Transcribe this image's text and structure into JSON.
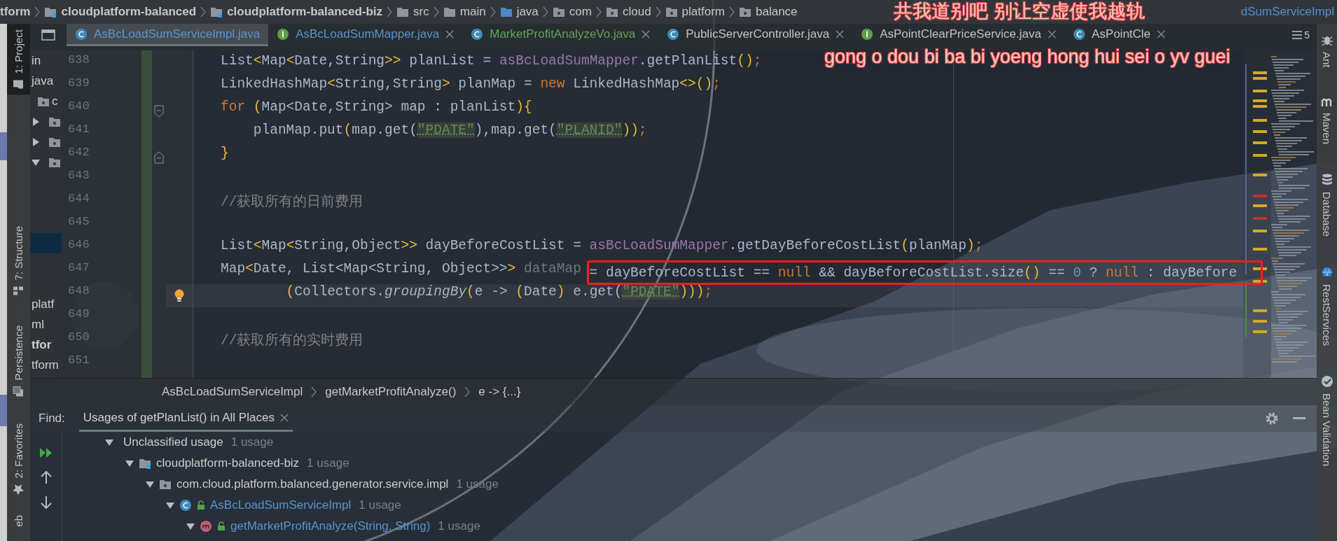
{
  "breadcrumbs": [
    {
      "label": "tform",
      "kind": "text"
    },
    {
      "label": "cloudplatform-balanced",
      "kind": "module"
    },
    {
      "label": "cloudplatform-balanced-biz",
      "kind": "module"
    },
    {
      "label": "src",
      "kind": "folder"
    },
    {
      "label": "main",
      "kind": "folder"
    },
    {
      "label": "java",
      "kind": "source"
    },
    {
      "label": "com",
      "kind": "package"
    },
    {
      "label": "cloud",
      "kind": "package"
    },
    {
      "label": "platform",
      "kind": "package"
    },
    {
      "label": "balance",
      "kind": "package"
    },
    {
      "label": "dSumServiceImpl",
      "kind": "class"
    }
  ],
  "lyrics_overlay": {
    "lines": [
      "共我道别吧 别让空虚使我越轨",
      "gong o dou bi ba bi yoeng hong hui sei o yv guei"
    ]
  },
  "left_tool_tabs": [
    {
      "label": "1: Project",
      "kind": "project",
      "selected": true
    },
    {
      "label": "7: Structure",
      "kind": "structure",
      "selected": false
    },
    {
      "label": "Persistence",
      "kind": "persistence",
      "selected": false
    },
    {
      "label": "2: Favorites",
      "kind": "favorites",
      "selected": false
    },
    {
      "label": "eb",
      "kind": "web",
      "selected": false
    }
  ],
  "right_tool_tabs": [
    {
      "label": "Ant",
      "kind": "ant"
    },
    {
      "label": "Maven",
      "kind": "maven"
    },
    {
      "label": "Database",
      "kind": "database"
    },
    {
      "label": "RestServices",
      "kind": "rest"
    },
    {
      "label": "Bean Validation",
      "kind": "bean"
    }
  ],
  "tabs": [
    {
      "label": "AsBcLoadSumServiceImpl.java",
      "kind": "class",
      "color": "#5895d0",
      "selected": true
    },
    {
      "label": "AsBcLoadSumMapper.java",
      "kind": "interface",
      "color": "#5895d0",
      "selected": false
    },
    {
      "label": "MarketProfitAnalyzeVo.java",
      "kind": "class",
      "color": "#62a55a",
      "selected": false
    },
    {
      "label": "PublicServerController.java",
      "kind": "class",
      "color": "#c2c2c2",
      "selected": false
    },
    {
      "label": "AsPointClearPriceService.java",
      "kind": "interface",
      "color": "#c2c2c2",
      "selected": false
    },
    {
      "label": "AsPointCle",
      "kind": "class",
      "color": "#c2c2c2",
      "selected": false
    }
  ],
  "tab_overflow": "5",
  "project_items": [
    {
      "label": "in",
      "kind": "text",
      "selected": false
    },
    {
      "label": "java",
      "kind": "text",
      "selected": false
    },
    {
      "label": "c",
      "kind": "package",
      "selected": false
    },
    {
      "kind": "node",
      "expanded": false,
      "selected": false
    },
    {
      "kind": "node",
      "expanded": false,
      "selected": false
    },
    {
      "kind": "node",
      "expanded": true,
      "selected": false
    },
    {
      "kind": "blank",
      "selected": true
    },
    {
      "label": "platf",
      "kind": "text",
      "selected": false
    },
    {
      "label": "ml",
      "kind": "text",
      "selected": false
    },
    {
      "label": "tfor",
      "kind": "module",
      "selected": false
    },
    {
      "label": "tform",
      "kind": "text",
      "selected": false
    }
  ],
  "editor": {
    "lines": [
      {
        "number": "638",
        "kind": "plain",
        "current": false,
        "tokens": [
          {
            "t": "List",
            "kind": "p"
          },
          {
            "t": "<",
            "kind": "b"
          },
          {
            "t": "Map",
            "kind": "p"
          },
          {
            "t": "<",
            "kind": "b"
          },
          {
            "t": "Date,String",
            "kind": "p"
          },
          {
            "t": ">>",
            "kind": "b"
          },
          {
            "t": " planList = ",
            "kind": "p"
          },
          {
            "t": "asBcLoadSumMapper",
            "kind": "f"
          },
          {
            "t": ".getPlanList",
            "kind": "p"
          },
          {
            "t": "()",
            "kind": "b"
          },
          {
            "t": ";",
            "kind": "kw"
          }
        ]
      },
      {
        "number": "639",
        "kind": "plain",
        "current": false,
        "tokens": [
          {
            "t": "LinkedHashMap",
            "kind": "p"
          },
          {
            "t": "<",
            "kind": "b"
          },
          {
            "t": "String,String",
            "kind": "p"
          },
          {
            "t": ">",
            "kind": "b"
          },
          {
            "t": " planMap = ",
            "kind": "p"
          },
          {
            "t": "new",
            "kind": "kw"
          },
          {
            "t": " LinkedHashMap",
            "kind": "p"
          },
          {
            "t": "<>",
            "kind": "b"
          },
          {
            "t": "()",
            "kind": "b"
          },
          {
            "t": ";",
            "kind": "kw"
          }
        ]
      },
      {
        "number": "640",
        "kind": "opener",
        "current": false,
        "tokens": [
          {
            "t": "for",
            "kind": "kw"
          },
          {
            "t": " (",
            "kind": "b"
          },
          {
            "t": "Map<Date,String> map : planList",
            "kind": "p"
          },
          {
            "t": ")",
            "kind": "b"
          },
          {
            "t": "{",
            "kind": "b"
          }
        ]
      },
      {
        "number": "641",
        "kind": "plain",
        "current": false,
        "tokens": [
          {
            "t": "    planMap.put",
            "kind": "p"
          },
          {
            "t": "(",
            "kind": "b"
          },
          {
            "t": "map.get(",
            "kind": "p"
          },
          {
            "t": "\"PDATE\"",
            "kind": "s"
          },
          {
            "t": "),map.get(",
            "kind": "p"
          },
          {
            "t": "\"PLANID\"",
            "kind": "s"
          },
          {
            "t": "))",
            "kind": "b"
          },
          {
            "t": ";",
            "kind": "kw"
          }
        ]
      },
      {
        "number": "642",
        "kind": "closer",
        "current": false,
        "tokens": [
          {
            "t": "}",
            "kind": "b"
          }
        ]
      },
      {
        "number": "643",
        "kind": "plain",
        "current": false
      },
      {
        "number": "644",
        "kind": "plain",
        "current": false,
        "tokens": [
          {
            "t": "//获取所有的日前费用",
            "kind": "c"
          }
        ]
      },
      {
        "number": "645",
        "kind": "plain",
        "current": false
      },
      {
        "number": "646",
        "kind": "plain",
        "current": false,
        "tokens": [
          {
            "t": "List",
            "kind": "p"
          },
          {
            "t": "<",
            "kind": "b"
          },
          {
            "t": "Map",
            "kind": "p"
          },
          {
            "t": "<",
            "kind": "b"
          },
          {
            "t": "String,Object",
            "kind": "p"
          },
          {
            "t": ">>",
            "kind": "b"
          },
          {
            "t": " dayBeforeCostList = ",
            "kind": "p"
          },
          {
            "t": "asBcLoadSumMapper",
            "kind": "f"
          },
          {
            "t": ".getDayBeforeCostList",
            "kind": "p"
          },
          {
            "t": "(",
            "kind": "b"
          },
          {
            "t": "planMap",
            "kind": "p"
          },
          {
            "t": ")",
            "kind": "b"
          },
          {
            "t": ";",
            "kind": "kw"
          }
        ]
      },
      {
        "number": "647",
        "kind": "plain",
        "current": false,
        "tokens": [
          {
            "t": "Map",
            "kind": "p"
          },
          {
            "t": "<",
            "kind": "b"
          },
          {
            "t": "Date, List<Map<String, Object>>",
            "kind": "p"
          },
          {
            "t": ">",
            "kind": "b"
          },
          {
            "t": " dataMap ",
            "kind": "d"
          }
        ],
        "framed_tokens": [
          {
            "t": "= dayBeforeCostList == ",
            "kind": "p"
          },
          {
            "t": "null",
            "kind": "kw"
          },
          {
            "t": " && dayBeforeCostList.size",
            "kind": "p"
          },
          {
            "t": "()",
            "kind": "b"
          },
          {
            "t": " == ",
            "kind": "p"
          },
          {
            "t": "0",
            "kind": "n"
          },
          {
            "t": " ? ",
            "kind": "p"
          },
          {
            "t": "null",
            "kind": "kw"
          },
          {
            "t": " : dayBefore",
            "kind": "p"
          }
        ]
      },
      {
        "number": "648",
        "kind": "plain",
        "current": true,
        "tokens": [
          {
            "t": "        (",
            "kind": "b"
          },
          {
            "t": "Collectors.",
            "kind": "p"
          },
          {
            "t": "groupingBy",
            "kind": "i"
          },
          {
            "t": "(",
            "kind": "b"
          },
          {
            "t": "e -> ",
            "kind": "p"
          },
          {
            "t": "(",
            "kind": "b"
          },
          {
            "t": "Date",
            "kind": "p"
          },
          {
            "t": ")",
            "kind": "b"
          },
          {
            "t": " e.get(",
            "kind": "p"
          },
          {
            "t": "\"PDATE\"",
            "kind": "s"
          },
          {
            "t": ")))",
            "kind": "b"
          },
          {
            "t": ";",
            "kind": "kw"
          }
        ]
      },
      {
        "number": "649",
        "kind": "plain",
        "current": false
      },
      {
        "number": "650",
        "kind": "plain",
        "current": false,
        "tokens": [
          {
            "t": "//获取所有的实时费用",
            "kind": "c"
          }
        ]
      },
      {
        "number": "651",
        "kind": "plain",
        "current": false
      }
    ]
  },
  "editor_breadcrumbs": [
    "AsBcLoadSumServiceImpl",
    "getMarketProfitAnalyze()",
    "e -> {...}"
  ],
  "find": {
    "label": "Find:",
    "tab": {
      "label": "Usages of getPlanList() in All Places",
      "selected": true
    },
    "tree": [
      {
        "label": "Unclassified usage",
        "count": "1 usage",
        "expanded": true,
        "children": [
          {
            "label": "cloudplatform-balanced-biz",
            "count": "1 usage",
            "kind": "module",
            "expanded": true,
            "children": [
              {
                "label": "com.cloud.platform.balanced.generator.service.impl",
                "count": "1 usage",
                "kind": "package",
                "expanded": true,
                "children": [
                  {
                    "label": "AsBcLoadSumServiceImpl",
                    "count": "1 usage",
                    "kind": "class",
                    "expanded": true,
                    "children": [
                      {
                        "label": "getMarketProfitAnalyze(String, String)",
                        "count": "1 usage",
                        "kind": "method",
                        "expanded": true
                      }
                    ]
                  }
                ]
              }
            ]
          }
        ]
      }
    ]
  }
}
